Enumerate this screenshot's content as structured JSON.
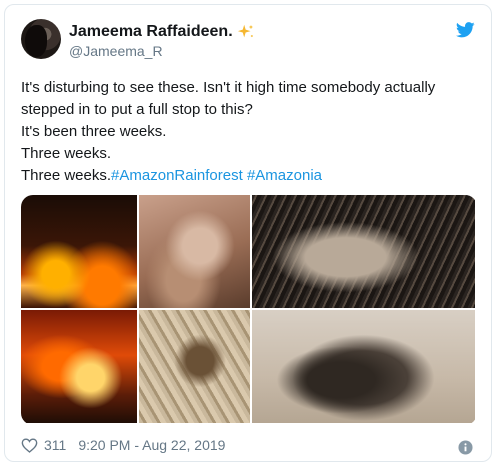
{
  "tweet": {
    "display_name": "Jameema Raffaideen.",
    "handle": "@Jameema_R",
    "lines": [
      "It's disturbing to see these. Isn't it high time somebody actually",
      "stepped in to put a full stop to this?",
      "It's been three weeks.",
      "Three weeks.",
      "Three weeks."
    ],
    "hashtags": [
      "#AmazonRainforest",
      "#Amazonia"
    ],
    "likes": "311",
    "timestamp": "9:20 PM - Aug 22, 2019"
  },
  "icons": {
    "verified_sparkle": "sparkle-icon",
    "brand": "twitter-bird-icon",
    "like": "heart-icon",
    "info": "info-icon"
  },
  "colors": {
    "link": "#1b95e0",
    "twitter_blue": "#1da1f2",
    "secondary_text": "#657786",
    "sparkle": "#f5b731"
  },
  "media": {
    "photos": [
      {
        "alt": "forest-fire-night"
      },
      {
        "alt": "monkey-screaming"
      },
      {
        "alt": "burned-animal-on-charred-ground"
      },
      {
        "alt": "forest-fire-flames"
      },
      {
        "alt": "burned-lizard"
      },
      {
        "alt": "burned-rabbit"
      }
    ]
  }
}
